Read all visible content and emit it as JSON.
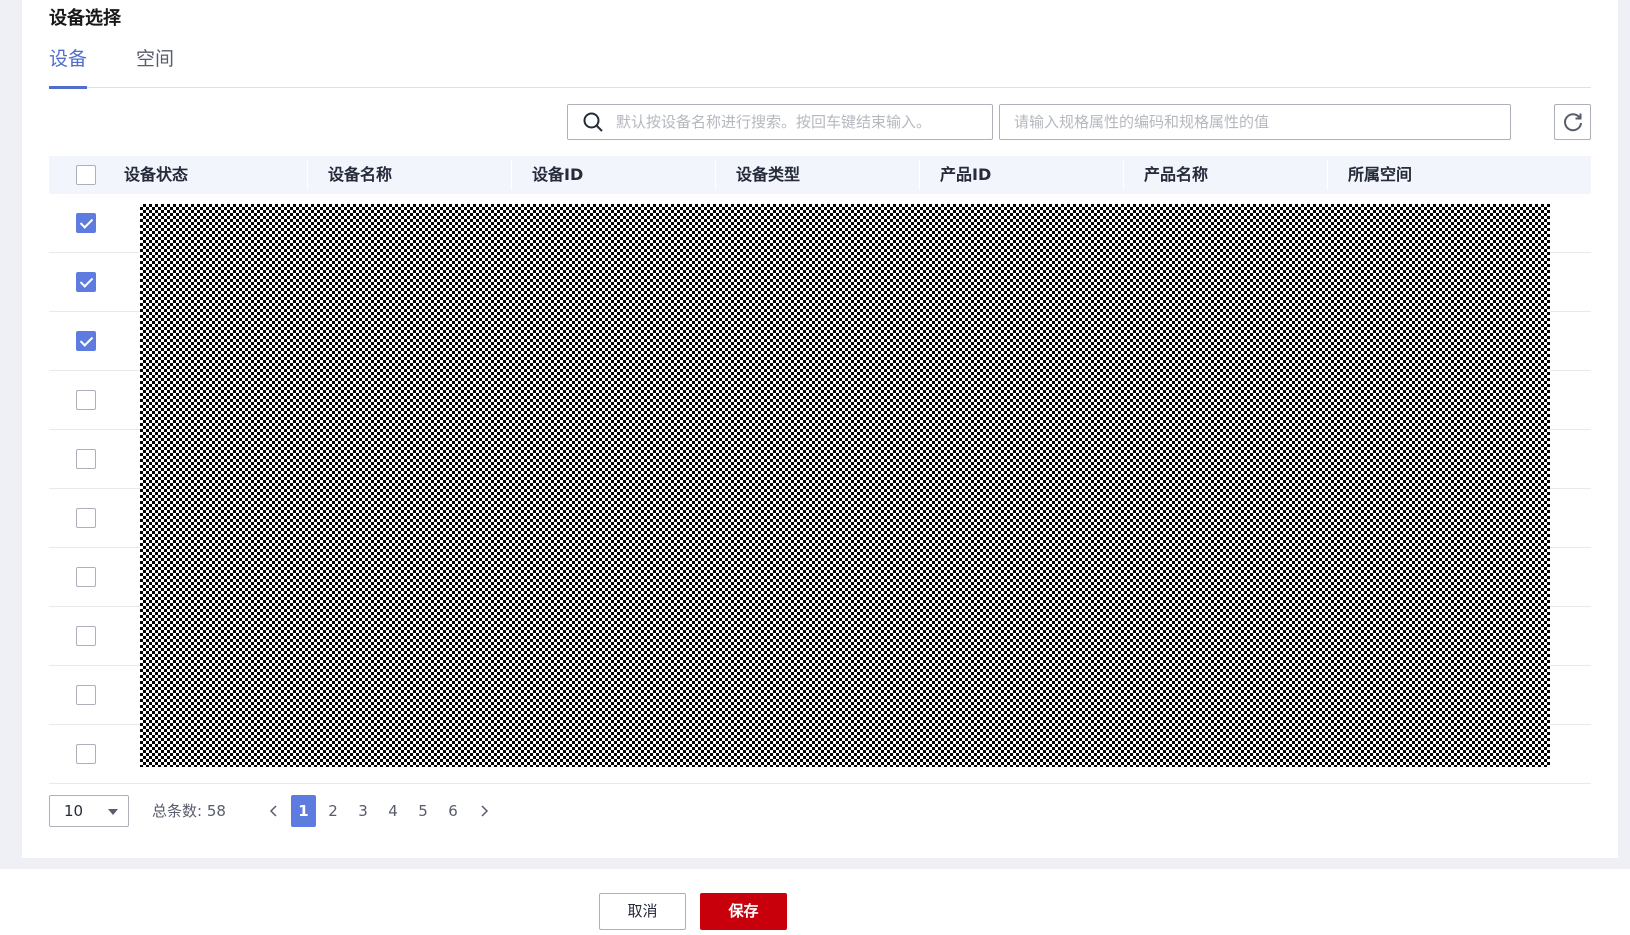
{
  "section": {
    "title": "设备选择"
  },
  "tabs": [
    {
      "label": "设备",
      "active": true
    },
    {
      "label": "空间",
      "active": false
    }
  ],
  "search": {
    "name_placeholder": "默认按设备名称进行搜索。按回车键结束输入。",
    "spec_placeholder": "请输入规格属性的编码和规格属性的值"
  },
  "table": {
    "columns": [
      "设备状态",
      "设备名称",
      "设备ID",
      "设备类型",
      "产品ID",
      "产品名称",
      "所属空间"
    ],
    "rows_checked": [
      true,
      true,
      true,
      false,
      false,
      false,
      false,
      false,
      false,
      false
    ]
  },
  "pagination": {
    "page_size": "10",
    "total_label": "总条数: 58",
    "pages": [
      "1",
      "2",
      "3",
      "4",
      "5",
      "6"
    ],
    "current_page": "1",
    "prev_icon": "chevron-left-icon",
    "next_icon": "chevron-right-icon"
  },
  "footer": {
    "cancel_label": "取消",
    "save_label": "保存"
  },
  "colors": {
    "accent": "#5e7ce0",
    "save": "#c7000b"
  }
}
